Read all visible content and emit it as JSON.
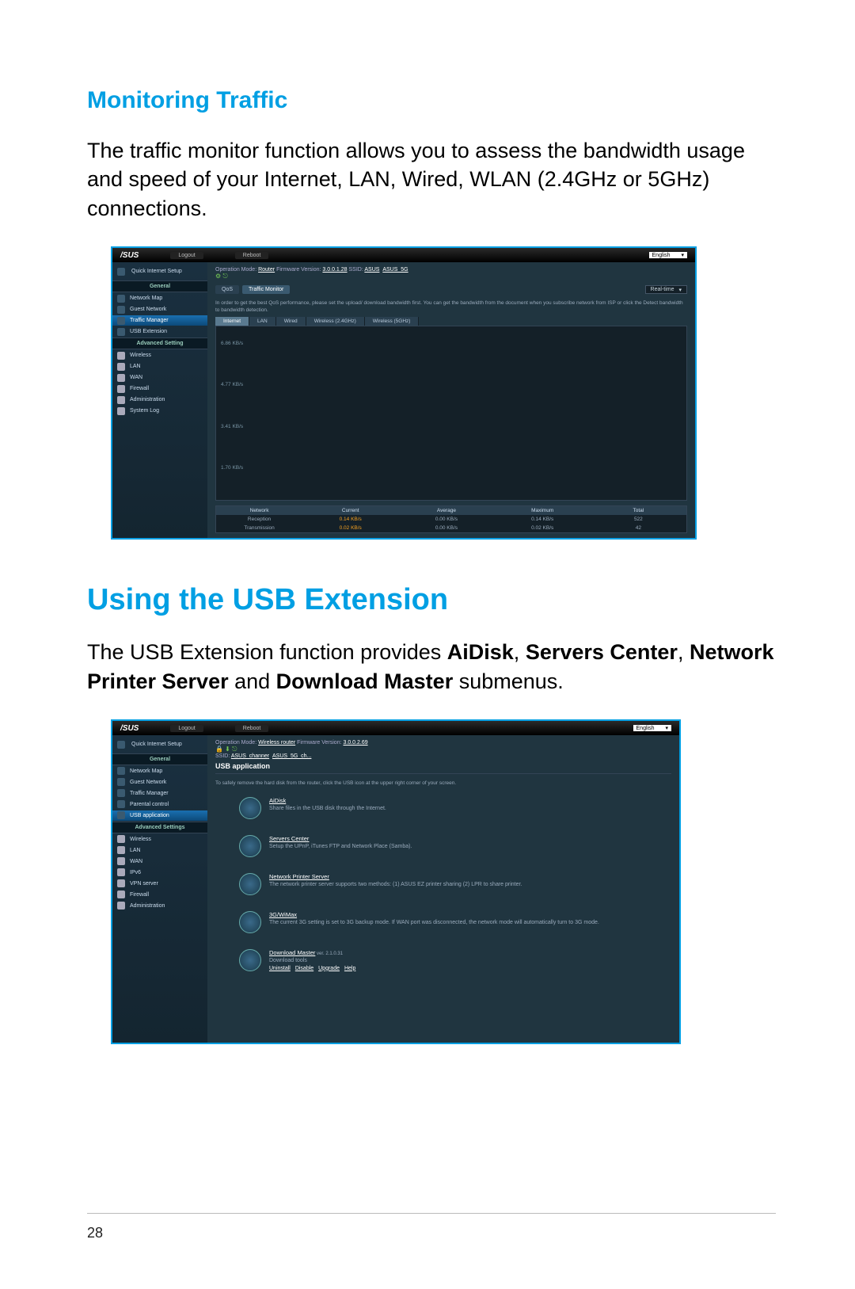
{
  "page_number": "28",
  "section1": {
    "heading": "Monitoring Traffic",
    "body": "The traffic monitor function allows you to assess the bandwidth usage and speed of your Internet, LAN, Wired, WLAN (2.4GHz or 5GHz) connections."
  },
  "section2": {
    "heading": "Using the USB Extension",
    "body_pre": "The USB Extension function provides ",
    "b1": "AiDisk",
    "sep1": ", ",
    "b2": "Servers Center",
    "sep2": ", ",
    "b3": "Network Printer Server",
    "sep3": " and ",
    "b4": "Download Master",
    "body_post": " submenus."
  },
  "shot1": {
    "logo": "/SUS",
    "logout": "Logout",
    "reboot": "Reboot",
    "lang": "English",
    "op_mode_label": "Operation Mode: ",
    "op_mode": "Router",
    "fw_label": "   Firmware Version: ",
    "fw": "3.0.0.1.28",
    "ssid_label": "   SSID: ",
    "ssid1": "ASUS",
    "ssid2": "ASUS_5G",
    "tab_qos": "QoS",
    "tab_tm": "Traffic Monitor",
    "rt": "Real-time",
    "hint": "In order to get the best QoS performance, please set the upload/ download bandwidth first. You can get the bandwidth from the document when you subscribe network from ISP or click the Detect bandwidth to bandwidth detection.",
    "subtabs": [
      "Internet",
      "LAN",
      "Wired",
      "Wireless (2.4GHz)",
      "Wireless (5GHz)"
    ],
    "y": [
      "6.86 KB/s",
      "4.77 KB/s",
      "3.41 KB/s",
      "1.70 KB/s"
    ],
    "cols": [
      "Network",
      "Current",
      "Average",
      "Maximum",
      "Total"
    ],
    "rows": [
      {
        "lab": "Reception",
        "cur": "0.14 KB/s",
        "avg": "0.00 KB/s",
        "max": "0.14 KB/s",
        "tot": "522"
      },
      {
        "lab": "Transmission",
        "cur": "0.02 KB/s",
        "avg": "0.00 KB/s",
        "max": "0.02 KB/s",
        "tot": "42"
      }
    ],
    "sidebar_quick": "Quick Internet Setup",
    "sidebar": {
      "head1": "General",
      "g": [
        "Network Map",
        "Guest Network",
        "Traffic Manager",
        "USB Extension"
      ],
      "head2": "Advanced Setting",
      "a": [
        "Wireless",
        "LAN",
        "WAN",
        "Firewall",
        "Administration",
        "System Log"
      ]
    }
  },
  "shot2": {
    "logo": "/SUS",
    "logout": "Logout",
    "reboot": "Reboot",
    "lang": "English",
    "op_mode_label": "Operation Mode: ",
    "op_mode": "Wireless router",
    "fw_label": "   Firmware Version: ",
    "fw": "3.0.0.2.69",
    "ssid_label": "SSID: ",
    "ssid1": "ASUS_channer",
    "ssid2": "ASUS_5G_ch...",
    "title": "USB application",
    "hint": "To safely remove the hard disk from the router, click the USB icon at the upper right corner of your screen.",
    "apps": [
      {
        "t": "AiDisk",
        "d": "Share files in the USB disk through the Internet."
      },
      {
        "t": "Servers Center",
        "d": "Setup the UPnP, iTunes FTP and Network Place (Samba)."
      },
      {
        "t": "Network Printer Server",
        "d": "The network printer server supports two methods: (1) ASUS EZ printer sharing (2) LPR to share printer."
      },
      {
        "t": "3G/WiMax",
        "d": "The current 3G setting is set to 3G backup mode. If WAN port was disconnected, the network mode will automatically turn to 3G mode."
      },
      {
        "t": "Download Master",
        "v": " ver. 2.1.0.31",
        "d": "Download tools",
        "links": [
          "Uninstall",
          "Disable",
          "Upgrade",
          "Help"
        ]
      }
    ],
    "sidebar_quick": "Quick Internet Setup",
    "sidebar": {
      "head1": "General",
      "g": [
        "Network Map",
        "Guest Network",
        "Traffic Manager",
        "Parental control",
        "USB application"
      ],
      "head2": "Advanced Settings",
      "a": [
        "Wireless",
        "LAN",
        "WAN",
        "IPv6",
        "VPN server",
        "Firewall",
        "Administration"
      ]
    }
  }
}
